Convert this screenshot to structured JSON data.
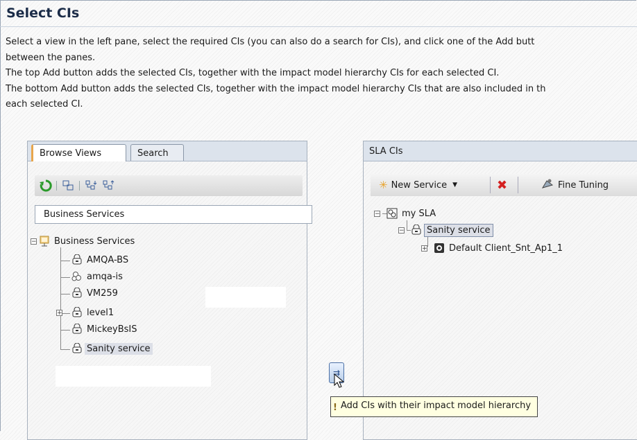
{
  "page": {
    "title": "Select CIs",
    "intro_lines": [
      "Select a view in the left pane, select the required CIs (you can also do a search for CIs), and click one of the Add butt",
      "between the panes.",
      "The top Add button adds the selected CIs, together with the impact model hierarchy CIs for each selected CI.",
      "The bottom Add button adds the selected CIs, together with the impact model hierarchy CIs that are also included in th",
      "each selected CI."
    ]
  },
  "left_panel": {
    "tabs": [
      {
        "label": "Browse Views",
        "active": true
      },
      {
        "label": "Search",
        "active": false
      }
    ],
    "toolbar_icons": [
      "refresh-icon",
      "show-hierarchy-icon",
      "expand-tree-icon",
      "collapse-tree-icon"
    ],
    "view_selector": {
      "value": "Business Services"
    },
    "tree": {
      "root": {
        "label": "Business Services",
        "icon": "business-services-view-icon",
        "expanded": true
      },
      "children": [
        {
          "label": "AMQA-BS",
          "icon": "business-service-icon"
        },
        {
          "label": "amqa-is",
          "icon": "infrastructure-service-icon"
        },
        {
          "label": "VM259",
          "icon": "business-service-icon"
        },
        {
          "label": "level1",
          "icon": "business-service-icon",
          "collapsed": true
        },
        {
          "label": "MickeyBsIS",
          "icon": "business-service-icon"
        },
        {
          "label": "Sanity service",
          "icon": "business-service-icon",
          "selected": true
        }
      ]
    }
  },
  "right_panel": {
    "title": "SLA CIs",
    "toolbar": {
      "new_service": "New Service",
      "fine_tuning": "Fine Tuning"
    },
    "tree": [
      {
        "label": "my SLA",
        "icon": "sla-icon",
        "expanded": true
      },
      {
        "label": "Sanity service",
        "icon": "business-service-icon",
        "expanded": true,
        "selected": true
      },
      {
        "label": "Default Client_Snt_Ap1_1",
        "icon": "monitor-icon",
        "collapsed": true
      }
    ]
  },
  "add_button": {
    "tooltip": "Add CIs with their impact model hierarchy"
  },
  "colors": {
    "title": "#1b2c48",
    "header_bg": "#dce3ec",
    "selection": "#dcdfe7",
    "tooltip_bg": "#ffffe1",
    "delete_red": "#d42020",
    "refresh_green": "#2a9a2a"
  }
}
